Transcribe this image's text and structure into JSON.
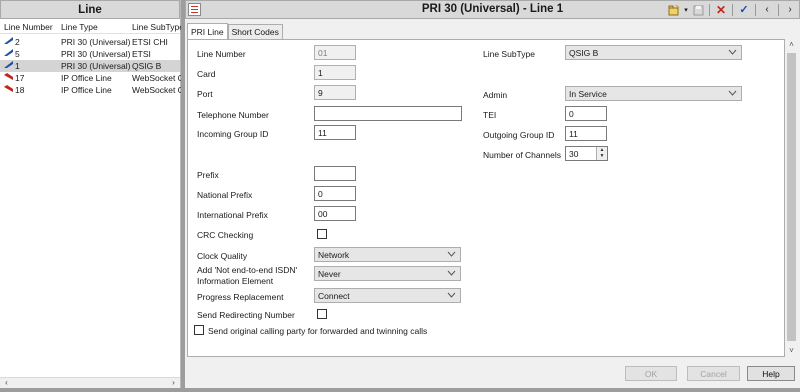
{
  "left_panel": {
    "title": "Line",
    "columns": [
      "Line Number",
      "Line Type",
      "Line SubType"
    ],
    "rows": [
      {
        "number": "2",
        "type": "PRI 30 (Universal)",
        "subtype": "ETSI CHI",
        "icon": "pri-line-icon",
        "selected": false
      },
      {
        "number": "5",
        "type": "PRI 30 (Universal)",
        "subtype": "ETSI",
        "icon": "pri-line-icon",
        "selected": false
      },
      {
        "number": "1",
        "type": "PRI 30 (Universal)",
        "subtype": "QSIG B",
        "icon": "pri-line-icon",
        "selected": true
      },
      {
        "number": "17",
        "type": "IP Office Line",
        "subtype": "WebSocket C",
        "icon": "ip-office-line-icon",
        "selected": false
      },
      {
        "number": "18",
        "type": "IP Office Line",
        "subtype": "WebSocket C",
        "icon": "ip-office-line-icon",
        "selected": false
      }
    ]
  },
  "detail": {
    "title": "PRI 30 (Universal) - Line 1",
    "tabs": [
      "PRI Line",
      "Short Codes"
    ],
    "fields": {
      "line_number": {
        "label": "Line Number",
        "value": "01"
      },
      "card": {
        "label": "Card",
        "value": "1"
      },
      "port": {
        "label": "Port",
        "value": "9"
      },
      "telephone_number": {
        "label": "Telephone Number",
        "value": ""
      },
      "incoming_group_id": {
        "label": "Incoming Group ID",
        "value": "11"
      },
      "prefix": {
        "label": "Prefix",
        "value": ""
      },
      "national_prefix": {
        "label": "National Prefix",
        "value": "0"
      },
      "international_prefix": {
        "label": "International Prefix",
        "value": "00"
      },
      "crc_checking": {
        "label": "CRC Checking",
        "checked": false
      },
      "clock_quality": {
        "label": "Clock Quality",
        "value": "Network"
      },
      "not_end_to_end": {
        "label_line1": "Add 'Not end-to-end ISDN'",
        "label_line2": "Information Element",
        "value": "Never"
      },
      "progress_replacement": {
        "label": "Progress Replacement",
        "value": "Connect"
      },
      "send_redirecting_number": {
        "label": "Send Redirecting Number",
        "checked": false
      },
      "send_original_calling_party": {
        "label": "Send original calling party for forwarded and twinning calls",
        "checked": false
      },
      "line_subtype": {
        "label": "Line SubType",
        "value": "QSIG B"
      },
      "admin": {
        "label": "Admin",
        "value": "In Service"
      },
      "tei": {
        "label": "TEI",
        "value": "0"
      },
      "outgoing_group_id": {
        "label": "Outgoing Group ID",
        "value": "11"
      },
      "number_of_channels": {
        "label": "Number of Channels",
        "value": "30"
      }
    },
    "buttons": {
      "ok": "OK",
      "cancel": "Cancel",
      "help": "Help"
    }
  }
}
